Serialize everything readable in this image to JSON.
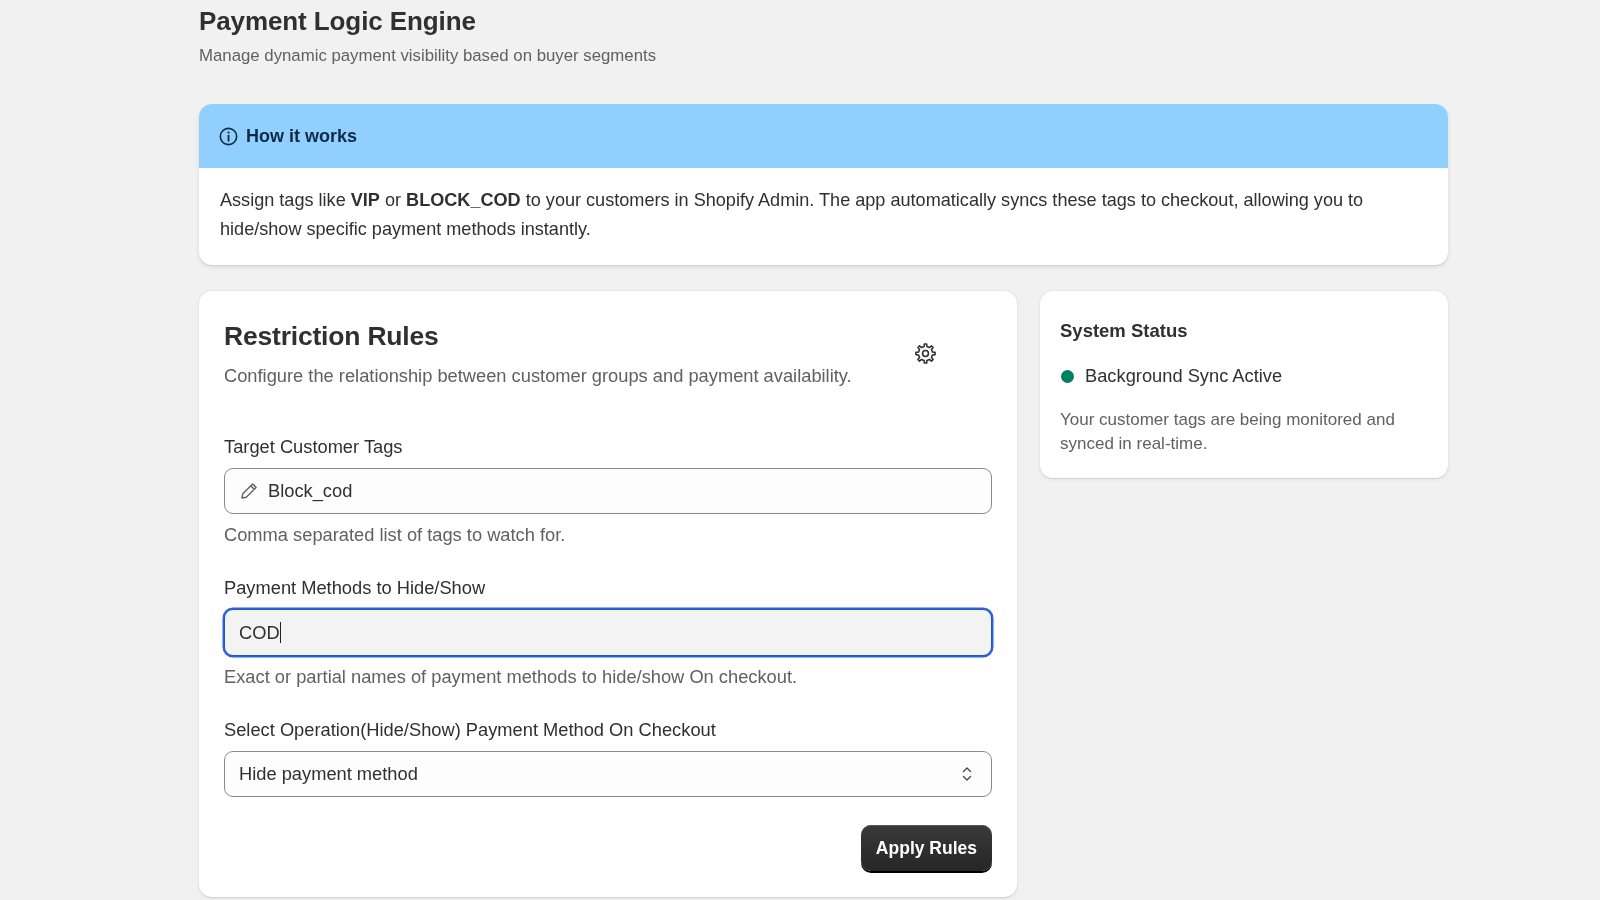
{
  "header": {
    "title": "Payment Logic Engine",
    "subtitle": "Manage dynamic payment visibility based on buyer segments"
  },
  "info_banner": {
    "title": "How it works",
    "text": "Assign tags like **VIP** or **BLOCK_COD** to your customers in Shopify Admin. The app automatically syncs these tags to checkout, allowing you to hide/show specific payment methods instantly."
  },
  "rules_card": {
    "title": "Restriction Rules",
    "description": "Configure the relationship between customer groups and payment availability.",
    "fields": [
      {
        "kind": "tags",
        "label": "Target Customer Tags",
        "value": "Block_cod",
        "help": "Comma separated list of tags to watch for.",
        "focused": false
      },
      {
        "kind": "text",
        "label": "Payment Methods to Hide/Show",
        "value": "COD",
        "help": "Exact or partial names of payment methods to hide/show On checkout.",
        "focused": true
      },
      {
        "kind": "select",
        "label": "Select Operation(Hide/Show) Payment Method On Checkout",
        "value": "Hide payment method",
        "focused": false
      }
    ],
    "button": "Apply Rules"
  },
  "status_card": {
    "title": "System Status",
    "status": {
      "label": "Background Sync Active",
      "color": "#008060"
    },
    "description": "Your customer tags are being monitored and synced in real-time."
  }
}
